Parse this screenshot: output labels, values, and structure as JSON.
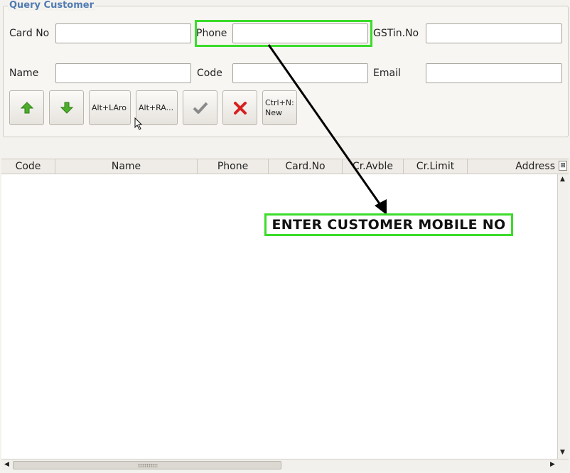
{
  "form": {
    "legend": "Query Customer",
    "card_no_label": "Card No",
    "phone_label": "Phone",
    "gstin_label": "GSTin.No",
    "name_label": "Name",
    "code_label": "Code",
    "email_label": "Email",
    "card_no_value": "",
    "phone_value": "",
    "gstin_value": "",
    "name_value": "",
    "code_value": "",
    "email_value": ""
  },
  "toolbar": {
    "up_icon": "green-arrow-up-icon",
    "down_icon": "green-arrow-down-icon",
    "prev_label": "Alt+LAro",
    "next_label": "Alt+RA...",
    "ok_icon": "checkmark-icon",
    "cancel_icon": "red-x-icon",
    "new_label": "Ctrl+N:\nNew"
  },
  "table": {
    "columns": [
      "Code",
      "Name",
      "Phone",
      "Card.No",
      "Cr.Avble",
      "Cr.Limit",
      "Address"
    ],
    "rows": []
  },
  "annotation": {
    "callout_text": "ENTER CUSTOMER MOBILE NO",
    "highlight_color": "#3bdc2a"
  }
}
